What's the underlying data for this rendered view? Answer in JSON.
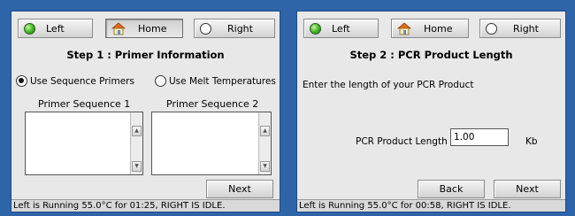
{
  "screens": [
    {
      "top_buttons": {
        "left": "Left",
        "home": "Home",
        "right": "Right"
      },
      "title": "Step 1 : Primer Information",
      "options": [
        {
          "label": "Use Sequence Primers",
          "selected": true
        },
        {
          "label": "Use Melt Temperatures",
          "selected": false
        }
      ],
      "primer_fields": [
        {
          "label": "Primer Sequence 1",
          "value": ""
        },
        {
          "label": "Primer Sequence 2",
          "value": ""
        }
      ],
      "next_label": "Next",
      "status": "Left is Running 55.0°C for 01:25, RIGHT IS IDLE."
    },
    {
      "top_buttons": {
        "left": "Left",
        "home": "Home",
        "right": "Right"
      },
      "title": "Step 2 : PCR Product Length",
      "prompt": "Enter the length of your PCR Product",
      "length_label": "PCR Product Length",
      "length_value": "1.00",
      "length_unit": "Kb",
      "back_label": "Back",
      "next_label": "Next",
      "status": "Left is Running 55.0°C for 00:58, RIGHT IS IDLE."
    }
  ],
  "icons": {
    "left_led": "green-led-icon",
    "home": "home-icon",
    "right_led": "radio-icon"
  },
  "colors": {
    "background": "#2e64a8",
    "panel": "#e8e8e8",
    "led_green": "#4fc02f"
  }
}
